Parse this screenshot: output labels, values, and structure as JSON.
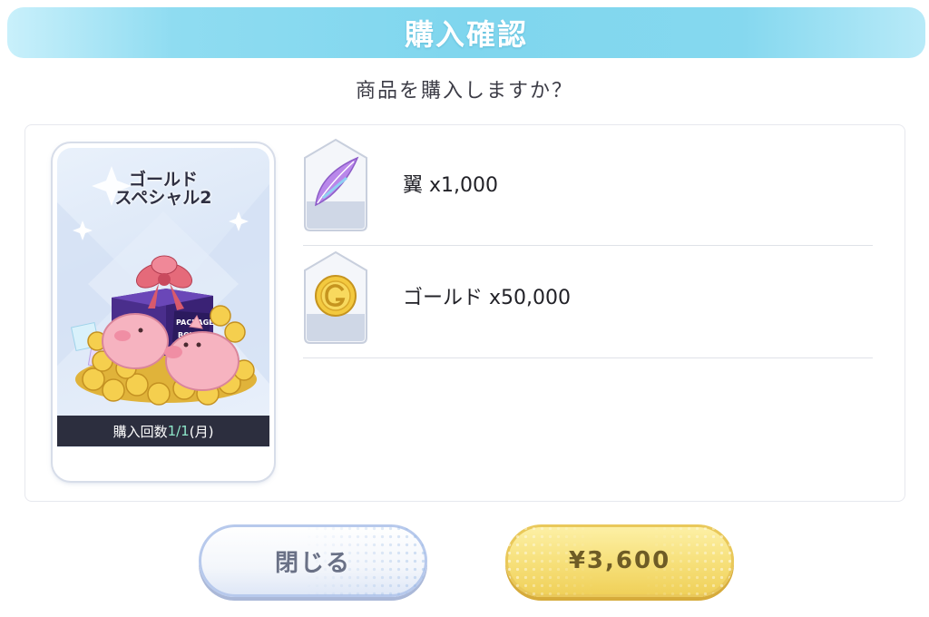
{
  "dialog": {
    "title": "購入確認",
    "question": "商品を購入しますか？"
  },
  "package": {
    "name_line1": "ゴールド",
    "name_line2": "スペシャル2",
    "purchase_count_prefix": "購入回数",
    "purchase_count_value": "1/1",
    "purchase_count_suffix": "(月)",
    "box_text_1": "PACKAGE",
    "box_text_2": "BOX"
  },
  "items": [
    {
      "icon": "feather-icon",
      "label": "翼 x1,000"
    },
    {
      "icon": "gold-coin-icon",
      "label": "ゴールド x50,000"
    }
  ],
  "buttons": {
    "close_label": "閉じる",
    "buy_label": "¥3,600"
  },
  "colors": {
    "title_bar": "#7fd6ee",
    "count_highlight": "#8ee6c9",
    "buy_button": "#f6df78",
    "close_button_border": "#b7c9ec"
  }
}
